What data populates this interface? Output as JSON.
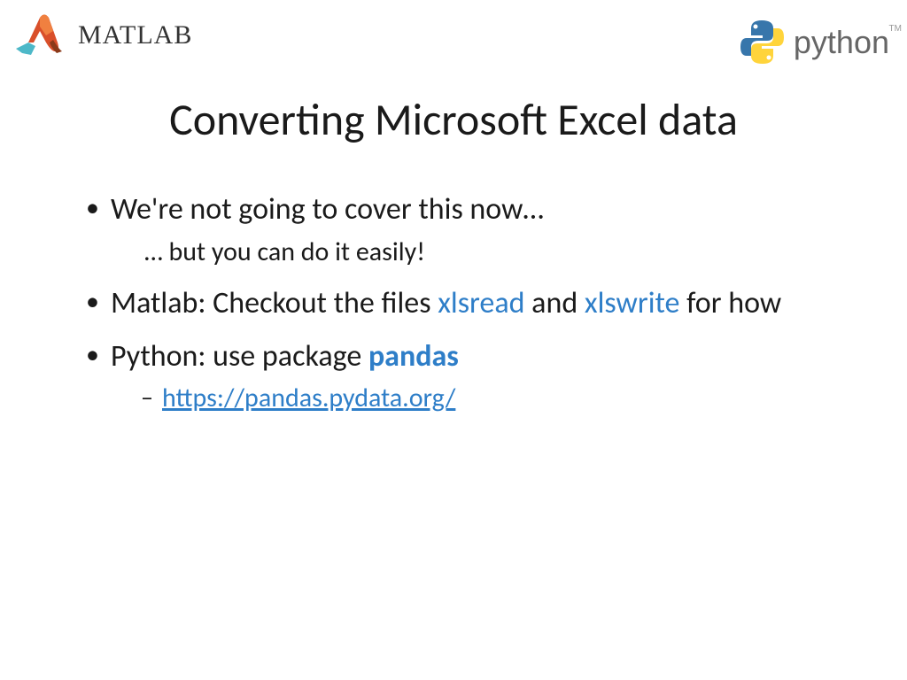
{
  "header": {
    "matlab_label": "MATLAB",
    "python_label": "python",
    "tm": "TM"
  },
  "title": "Converting Microsoft Excel data",
  "bullets": {
    "b1": "We're not going to cover this now…",
    "b1_sub": "… but you can do it easily!",
    "b2_pre": "Matlab: Checkout the files ",
    "b2_kw1": "xlsread",
    "b2_mid": " and ",
    "b2_kw2": "xlswrite",
    "b2_post": " for how",
    "b3_pre": "Python: use package ",
    "b3_kw": "pandas",
    "b3_link": "https://pandas.pydata.org/"
  }
}
